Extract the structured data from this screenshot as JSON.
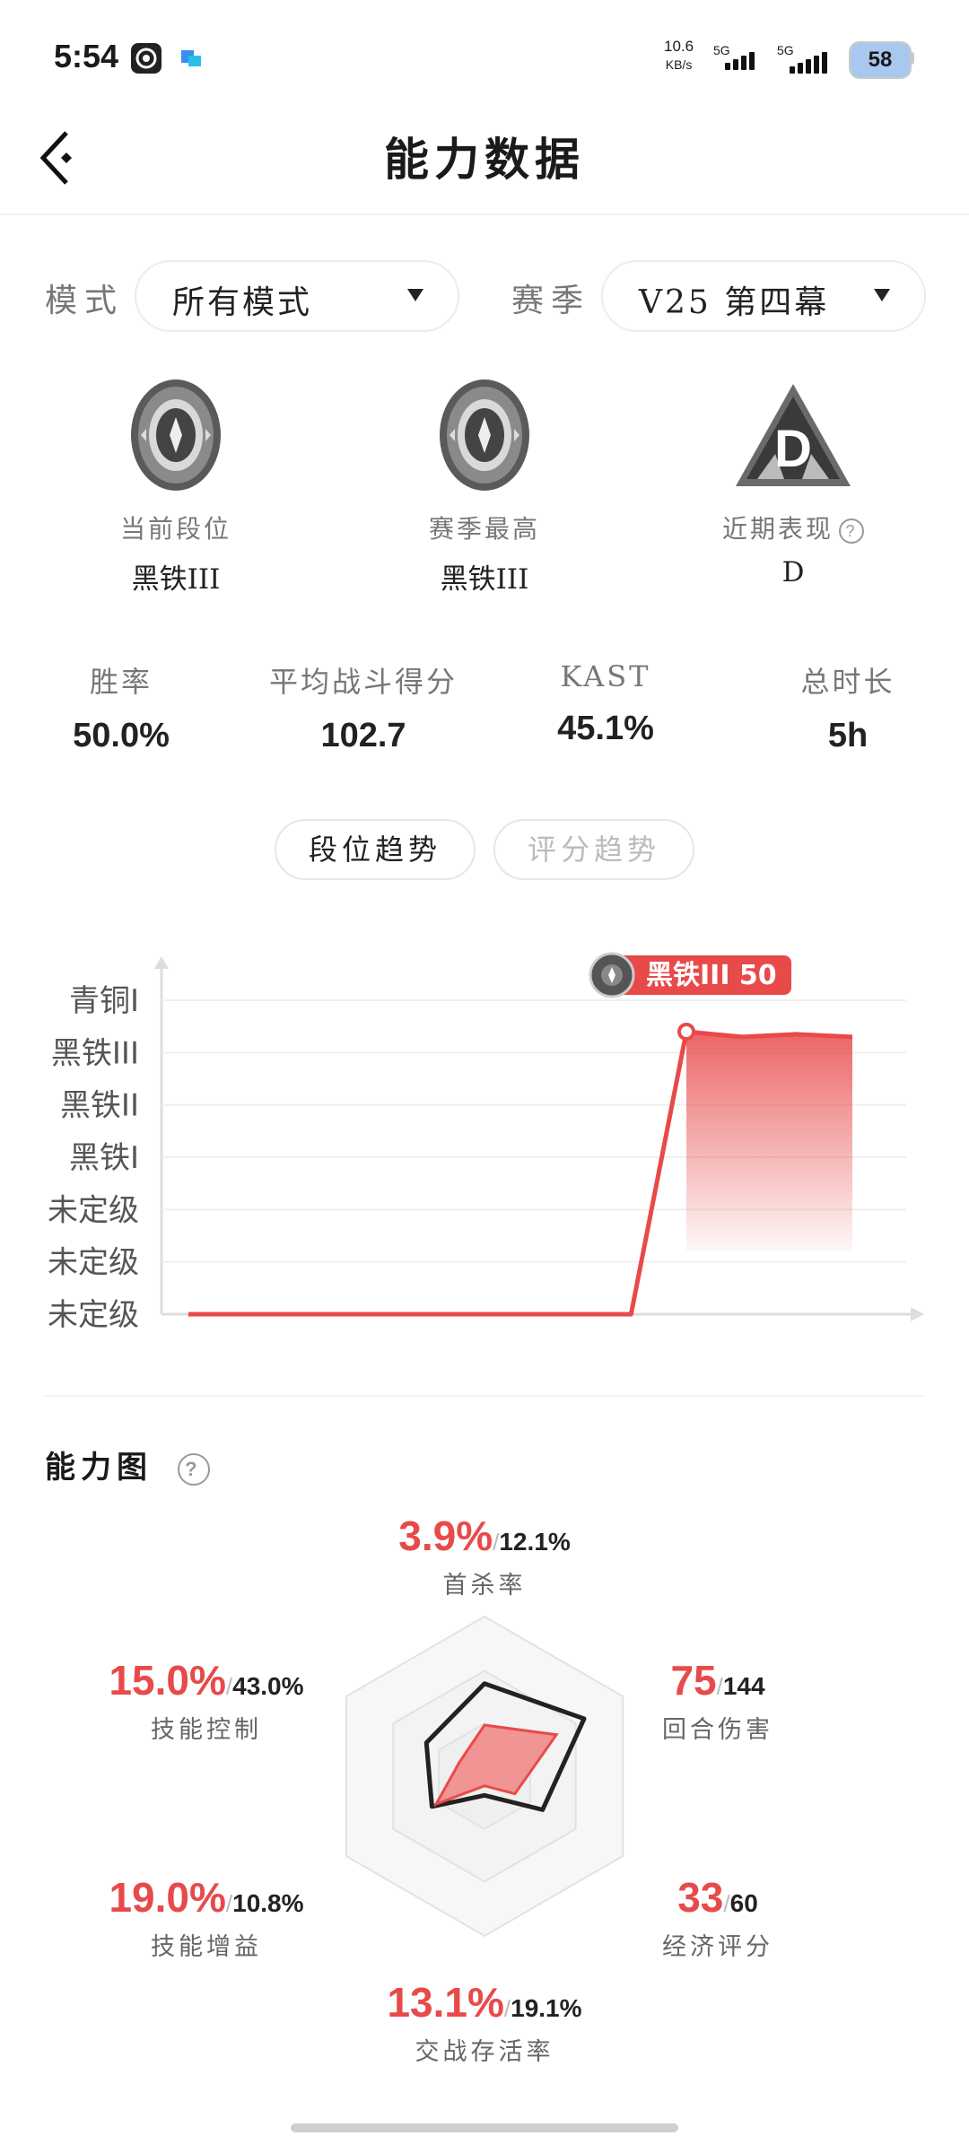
{
  "status_bar": {
    "time": "5:54",
    "net_speed_value": "10.6",
    "net_speed_unit": "KB/s",
    "sim1": "5G",
    "sim2": "5G",
    "battery": "58"
  },
  "header": {
    "title": "能力数据"
  },
  "filters": {
    "mode_label": "模式",
    "mode_value": "所有模式",
    "season_label": "赛季",
    "season_value": "V25 第四幕"
  },
  "ranks": [
    {
      "caption": "当前段位",
      "value": "黑铁III"
    },
    {
      "caption": "赛季最高",
      "value": "黑铁III"
    },
    {
      "caption": "近期表现",
      "value": "D",
      "badge_letter": "D"
    }
  ],
  "stats": [
    {
      "label": "胜率",
      "value": "50.0%"
    },
    {
      "label": "平均战斗得分",
      "value": "102.7"
    },
    {
      "label": "KAST",
      "value": "45.1%"
    },
    {
      "label": "总时长",
      "value": "5h"
    }
  ],
  "tabs": [
    {
      "label": "段位趋势",
      "active": true
    },
    {
      "label": "评分趋势",
      "active": false
    }
  ],
  "chart_data": {
    "type": "area",
    "y_categories": [
      "未定级",
      "未定级",
      "未定级",
      "黑铁I",
      "黑铁II",
      "黑铁III",
      "青铜I"
    ],
    "series": [
      {
        "values": [
          0,
          0,
          0,
          0,
          0,
          0,
          0,
          0,
          0,
          5.4,
          5.3,
          5.35,
          5.3
        ]
      }
    ],
    "tooltip": "黑铁III 50",
    "color": "#e84a4a"
  },
  "ability": {
    "title": "能力图",
    "help_icon": "?",
    "axes": [
      {
        "caption": "首杀率",
        "mine": "3.9%",
        "avg": "12.1%",
        "mine_ratio": 0.32,
        "avg_ratio": 0.58
      },
      {
        "caption": "回合伤害",
        "mine": "75",
        "avg": "144",
        "mine_ratio": 0.52,
        "avg_ratio": 0.72
      },
      {
        "caption": "经济评分",
        "mine": "33",
        "avg": "60",
        "mine_ratio": 0.22,
        "avg_ratio": 0.42
      },
      {
        "caption": "交战存活率",
        "mine": "13.1%",
        "avg": "19.1%",
        "mine_ratio": 0.06,
        "avg_ratio": 0.12
      },
      {
        "caption": "技能增益",
        "mine": "19.0%",
        "avg": "10.8%",
        "mine_ratio": 0.35,
        "avg_ratio": 0.38
      },
      {
        "caption": "技能控制",
        "mine": "15.0%",
        "avg": "43.0%",
        "mine_ratio": 0.18,
        "avg_ratio": 0.42
      }
    ]
  },
  "colors": {
    "accent": "#e84a4a",
    "text": "#1a1a1a",
    "muted": "#777777"
  }
}
